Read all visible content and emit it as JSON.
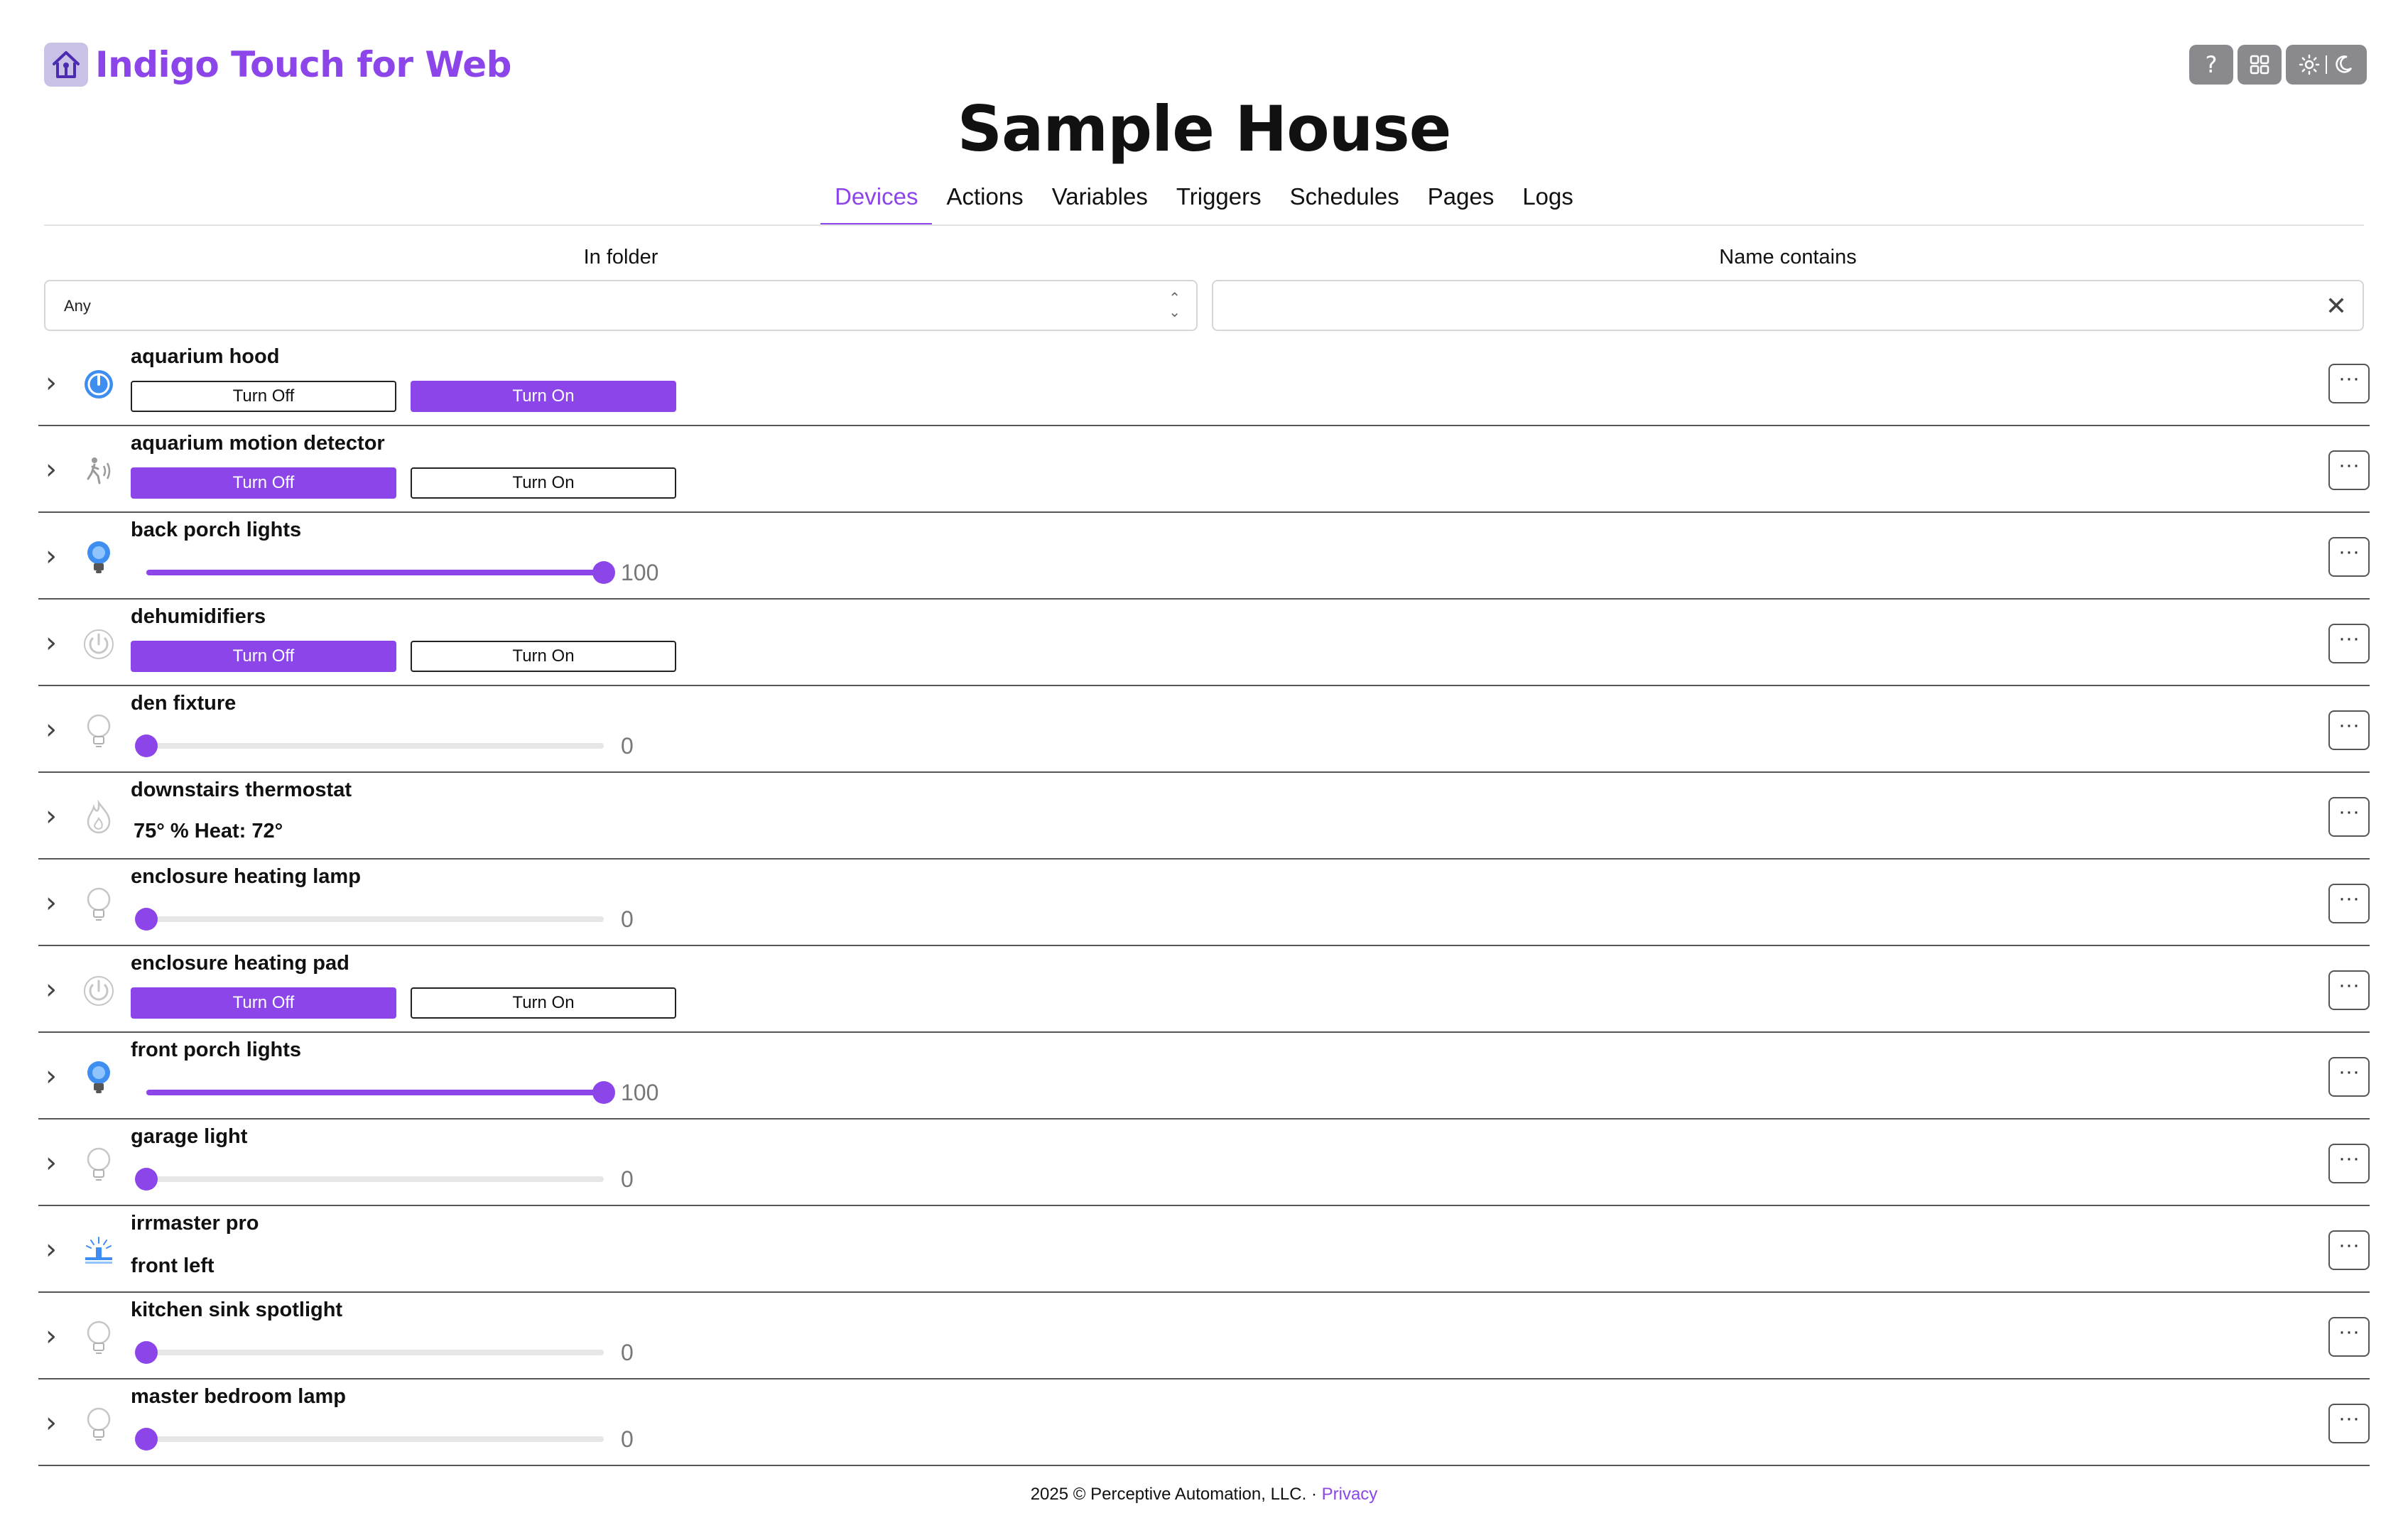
{
  "app": {
    "brand_title": "Indigo Touch for Web",
    "page_title": "Sample House",
    "accent_color": "#8c45e8"
  },
  "toolbar": {
    "help_label": "?",
    "grid_icon": "grid-icon",
    "theme_icons": "sun-icon / moon-icon"
  },
  "nav": {
    "tabs": [
      {
        "label": "Devices",
        "active": true
      },
      {
        "label": "Actions",
        "active": false
      },
      {
        "label": "Variables",
        "active": false
      },
      {
        "label": "Triggers",
        "active": false
      },
      {
        "label": "Schedules",
        "active": false
      },
      {
        "label": "Pages",
        "active": false
      },
      {
        "label": "Logs",
        "active": false
      }
    ]
  },
  "filters": {
    "folder_label": "In folder",
    "folder_value": "Any",
    "name_label": "Name contains",
    "name_value": ""
  },
  "devices": [
    {
      "name": "aquarium hood",
      "icon": "power-icon-on",
      "type": "onoff",
      "off_label": "Turn Off",
      "on_label": "Turn On",
      "state": "on"
    },
    {
      "name": "aquarium motion detector",
      "icon": "motion-sensor-icon",
      "type": "onoff",
      "off_label": "Turn Off",
      "on_label": "Turn On",
      "state": "off"
    },
    {
      "name": "back porch lights",
      "icon": "bulb-icon-on",
      "type": "dimmer",
      "level": 100,
      "level_label": "100"
    },
    {
      "name": "dehumidifiers",
      "icon": "power-icon-off",
      "type": "onoff",
      "off_label": "Turn Off",
      "on_label": "Turn On",
      "state": "off"
    },
    {
      "name": "den fixture",
      "icon": "bulb-icon-off",
      "type": "dimmer",
      "level": 0,
      "level_label": "0"
    },
    {
      "name": "downstairs thermostat",
      "icon": "flame-icon",
      "type": "status",
      "status": "75° % Heat:  72°"
    },
    {
      "name": "enclosure heating lamp",
      "icon": "bulb-icon-off",
      "type": "dimmer",
      "level": 0,
      "level_label": "0"
    },
    {
      "name": "enclosure heating pad",
      "icon": "power-icon-off",
      "type": "onoff",
      "off_label": "Turn Off",
      "on_label": "Turn On",
      "state": "off"
    },
    {
      "name": "front porch lights",
      "icon": "bulb-icon-on",
      "type": "dimmer",
      "level": 100,
      "level_label": "100"
    },
    {
      "name": "garage light",
      "icon": "bulb-icon-off",
      "type": "dimmer",
      "level": 0,
      "level_label": "0"
    },
    {
      "name": "irrmaster pro",
      "icon": "sprinkler-icon",
      "type": "sub",
      "sub": "front left"
    },
    {
      "name": "kitchen sink spotlight",
      "icon": "bulb-icon-off",
      "type": "dimmer",
      "level": 0,
      "level_label": "0"
    },
    {
      "name": "master bedroom lamp",
      "icon": "bulb-icon-off",
      "type": "dimmer",
      "level": 0,
      "level_label": "0"
    }
  ],
  "row_menu_label": "···",
  "footer": {
    "copyright": "2025 © Perceptive Automation, LLC. ·",
    "privacy_label": "Privacy"
  }
}
